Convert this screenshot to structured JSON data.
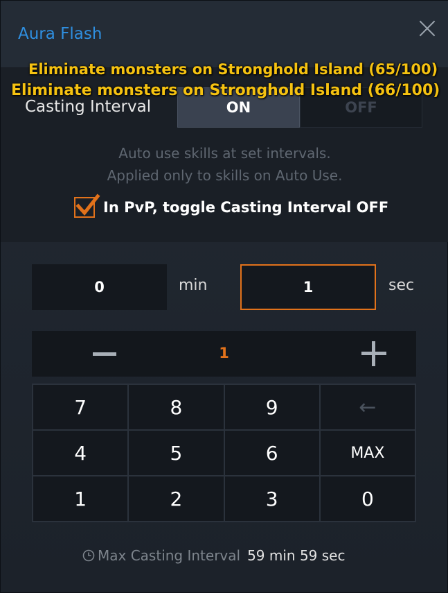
{
  "dialog": {
    "title": "Aura Flash"
  },
  "quests": [
    "Eliminate monsters on Stronghold Island (65/100)",
    "Eliminate monsters on Stronghold Island (66/100)"
  ],
  "casting_interval": {
    "label": "Casting Interval",
    "on_label": "ON",
    "off_label": "OFF",
    "selected": "ON",
    "desc_line1": "Auto use skills at set intervals.",
    "desc_line2": "Applied only to skills on Auto Use.",
    "pvp_label": "In PvP, toggle Casting Interval OFF",
    "pvp_checked": true
  },
  "time": {
    "min_value": "0",
    "min_unit": "min",
    "sec_value": "1",
    "sec_unit": "sec"
  },
  "stepper": {
    "value": "1"
  },
  "keypad": {
    "keys": [
      "7",
      "8",
      "9",
      "←",
      "4",
      "5",
      "6",
      "MAX",
      "1",
      "2",
      "3",
      "0"
    ]
  },
  "footer": {
    "label": "Max Casting Interval",
    "value": "59 min 59 sec"
  },
  "colors": {
    "accent": "#e2721b",
    "title": "#2f8fe0",
    "quest": "#f5c211"
  }
}
